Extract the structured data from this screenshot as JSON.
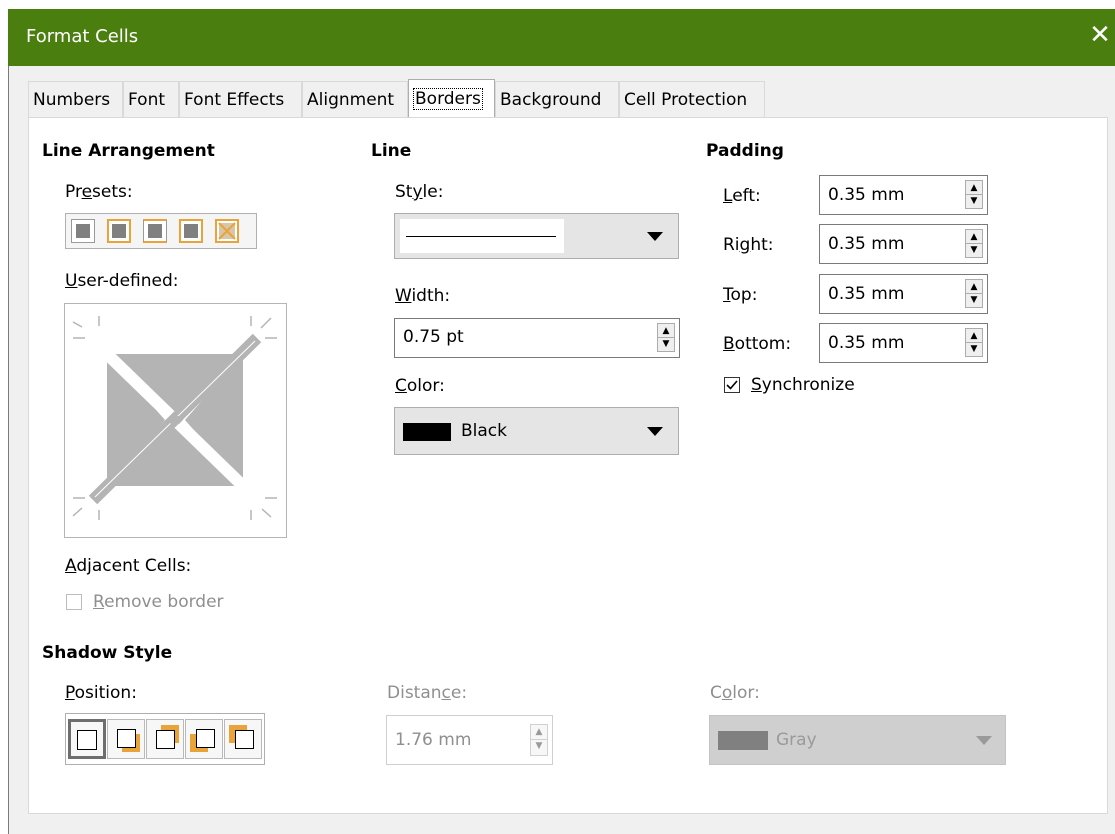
{
  "window": {
    "title": "Format Cells",
    "close_glyph": "✕"
  },
  "tabs": [
    {
      "label": "Numbers"
    },
    {
      "label": "Font"
    },
    {
      "label": "Font Effects"
    },
    {
      "label": "Alignment"
    },
    {
      "label": "Borders",
      "active": true
    },
    {
      "label": "Background"
    },
    {
      "label": "Cell Protection"
    }
  ],
  "line_arrangement": {
    "heading": "Line Arrangement",
    "presets_label_pre": "Pr",
    "presets_label_acc": "e",
    "presets_label_post": "sets:",
    "user_defined_label_acc": "U",
    "user_defined_label_post": "ser-defined:",
    "adjacent_label_acc": "A",
    "adjacent_label_post": "djacent Cells:",
    "remove_border_acc": "R",
    "remove_border_post": "emove border",
    "remove_border_checked": false
  },
  "line": {
    "heading": "Line",
    "style_label_pre": "St",
    "style_label_acc": "y",
    "style_label_post": "le:",
    "width_label_acc": "W",
    "width_label_post": "idth:",
    "width_value": "0.75 pt",
    "color_label_acc": "C",
    "color_label_post": "olor:",
    "color_value": "Black",
    "color_swatch": "#000000"
  },
  "padding": {
    "heading": "Padding",
    "left_acc": "L",
    "left_post": "eft:",
    "left_value": "0.35 mm",
    "right_pre": "Ri",
    "right_acc": "g",
    "right_post": "ht:",
    "right_value": "0.35 mm",
    "top_acc": "T",
    "top_post": "op:",
    "top_value": "0.35 mm",
    "bottom_acc": "B",
    "bottom_post": "ottom:",
    "bottom_value": "0.35 mm",
    "sync_acc": "S",
    "sync_post": "ynchronize",
    "sync_checked": true
  },
  "shadow": {
    "heading": "Shadow Style",
    "position_acc": "P",
    "position_post": "osition:",
    "distance_pre": "Distan",
    "distance_acc": "c",
    "distance_post": "e:",
    "distance_value": "1.76 mm",
    "color_pre": "C",
    "color_acc": "o",
    "color_post": "lor:",
    "color_value": "Gray",
    "color_swatch": "#808080"
  },
  "colors": {
    "titlebar": "#4a7f0f",
    "accent_orange": "#e8a33b"
  }
}
